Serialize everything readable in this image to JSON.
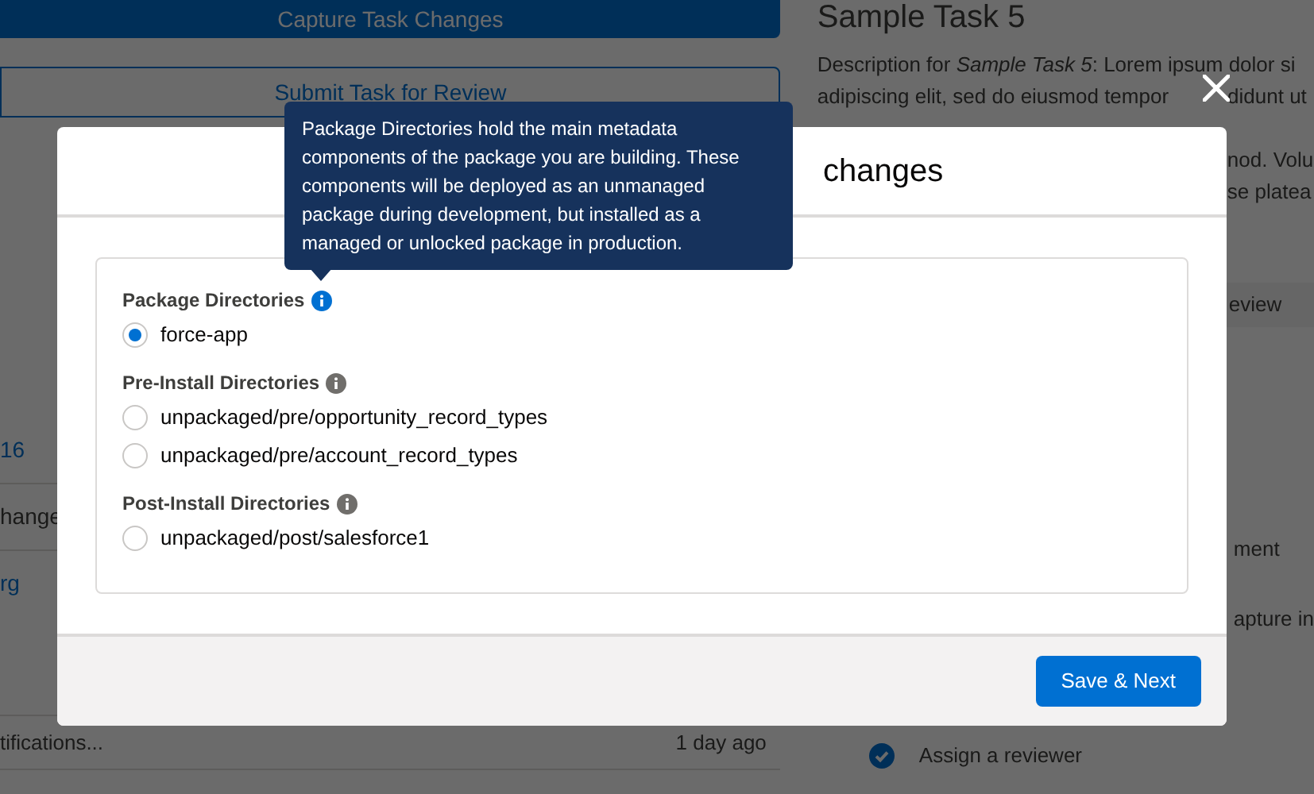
{
  "background": {
    "capture_button": "Capture Task Changes",
    "submit_button": "Submit Task for Review",
    "list": [
      {
        "kind": "link",
        "text": "16"
      },
      {
        "kind": "text",
        "text": "hange"
      },
      {
        "kind": "link",
        "text": "rg"
      }
    ],
    "notification": {
      "text": "tifications...",
      "time": "1 day ago"
    },
    "task": {
      "title": "Sample Task 5",
      "description": [
        [
          "Description for *Sample Task 5*: Lorem ipsum dolor si"
        ],
        [
          "adipiscing elit, sed do eiusmod tempor",
          "didunt ut"
        ]
      ],
      "description_tail": [
        "nod. Volu",
        "se platea"
      ],
      "tab": "eview",
      "steps": [
        {
          "text": "ment",
          "done": false
        },
        {
          "text": "apture in",
          "done": false
        },
        {
          "text": "Assign a reviewer",
          "done": true
        }
      ]
    }
  },
  "modal": {
    "title": "changes",
    "tooltip": "Package Directories hold the main metadata components of the package you are building. These components will be deployed as an unmanaged package during development, but installed as a managed or unlocked package in production.",
    "sections": [
      {
        "label": "Package Directories",
        "info_active": true,
        "options": [
          {
            "label": "force-app",
            "selected": true
          }
        ]
      },
      {
        "label": "Pre-Install Directories",
        "info_active": false,
        "options": [
          {
            "label": "unpackaged/pre/opportunity_record_types",
            "selected": false
          },
          {
            "label": "unpackaged/pre/account_record_types",
            "selected": false
          }
        ]
      },
      {
        "label": "Post-Install Directories",
        "info_active": false,
        "options": [
          {
            "label": "unpackaged/post/salesforce1",
            "selected": false
          }
        ]
      }
    ],
    "save_button": "Save & Next"
  }
}
